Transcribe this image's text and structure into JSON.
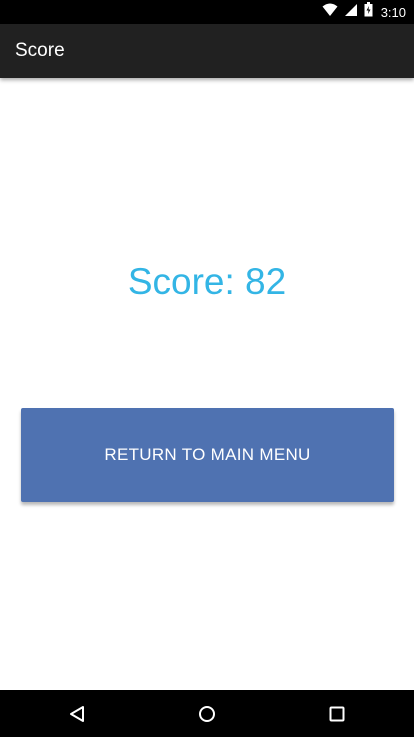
{
  "status_bar": {
    "time": "3:10",
    "icons": [
      "wifi-icon",
      "signal-icon",
      "battery-icon"
    ]
  },
  "app_bar": {
    "title": "Score"
  },
  "main": {
    "score_text": "Score: 82",
    "return_button_label": "RETURN TO MAIN MENU"
  },
  "nav_bar": {
    "buttons": [
      "back-icon",
      "home-icon",
      "recents-icon"
    ]
  },
  "colors": {
    "app_bar": "#212121",
    "score_text": "#33b5e5",
    "button": "#4f72b1",
    "background": "#ffffff"
  }
}
